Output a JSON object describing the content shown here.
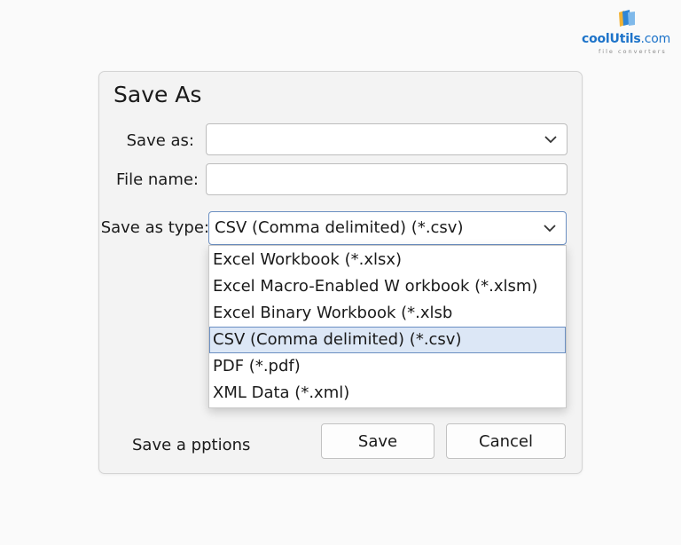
{
  "brand": {
    "name": "coolUtils",
    "tld": ".com",
    "tagline": "file converters",
    "color": "#1d73c9",
    "icon": "page-stack-icon"
  },
  "dialog": {
    "title": "Save As",
    "save_as": {
      "label": "Save as:",
      "value": ""
    },
    "file_name": {
      "label": "File name:",
      "value": ""
    },
    "save_as_type": {
      "label": "Save as type:",
      "selected": "CSV (Comma delimited) (*.csv)",
      "expanded": true,
      "options": [
        "Excel Workbook (*.xlsx)",
        "Excel Macro-Enabled W orkbook (*.xlsm)",
        "Excel Binary Workbook (*.xlsb",
        "CSV (Comma delimited) (*.csv)",
        "PDF (*.pdf)",
        "XML Data (*.xml)"
      ],
      "highlighted_index": 3,
      "highlight_color": "#dce7f6"
    },
    "save_options_label": "Save a pptions",
    "buttons": {
      "save": "Save",
      "cancel": "Cancel"
    }
  }
}
